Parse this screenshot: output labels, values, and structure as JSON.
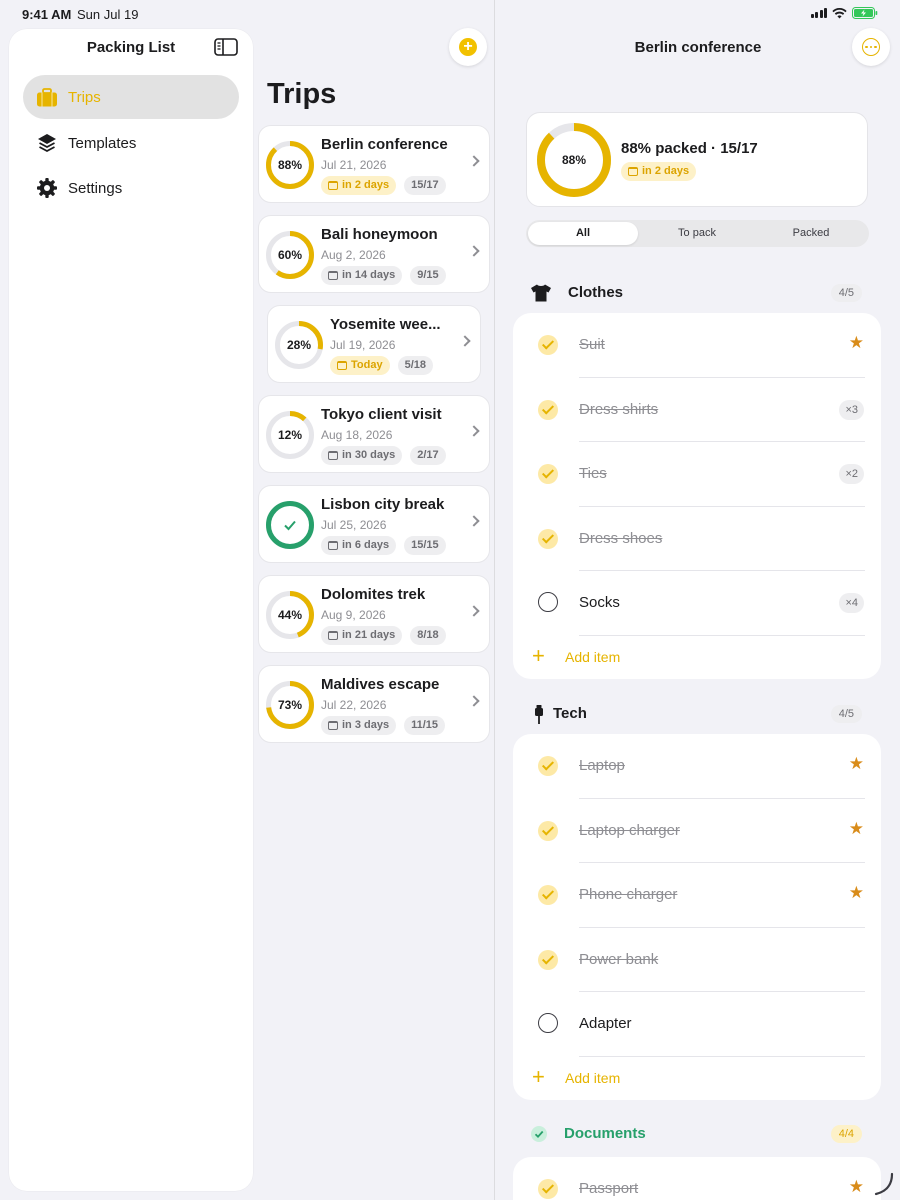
{
  "status": {
    "time": "9:41 AM",
    "date": "Sun Jul 19"
  },
  "sidebar": {
    "title": "Packing List",
    "items": [
      {
        "label": "Trips",
        "icon": "suitcase-icon",
        "active": true
      },
      {
        "label": "Templates",
        "icon": "layers-icon",
        "active": false
      },
      {
        "label": "Settings",
        "icon": "gear-icon",
        "active": false
      }
    ]
  },
  "trips": {
    "title": "Trips",
    "list": [
      {
        "name": "Berlin conference",
        "date": "Jul 21, 2026",
        "when": "in 2 days",
        "count": "15/17",
        "percent_label": "88%",
        "progress": 0.88,
        "urgent": true
      },
      {
        "name": "Bali honeymoon",
        "date": "Aug 2, 2026",
        "when": "in 14 days",
        "count": "9/15",
        "percent_label": "60%",
        "progress": 0.6,
        "urgent": false
      },
      {
        "name": "Yosemite wee...",
        "date": "Jul 19, 2026",
        "when": "Today",
        "count": "5/18",
        "percent_label": "28%",
        "progress": 0.28,
        "urgent": true
      },
      {
        "name": "Tokyo client visit",
        "date": "Aug 18, 2026",
        "when": "in 30 days",
        "count": "2/17",
        "percent_label": "12%",
        "progress": 0.12,
        "urgent": false
      },
      {
        "name": "Lisbon city break",
        "date": "Jul 25, 2026",
        "when": "in 6 days",
        "count": "15/15",
        "percent_label": "",
        "progress": 1.0,
        "urgent": false
      },
      {
        "name": "Dolomites trek",
        "date": "Aug 9, 2026",
        "when": "in 21 days",
        "count": "8/18",
        "percent_label": "44%",
        "progress": 0.44,
        "urgent": false
      },
      {
        "name": "Maldives escape",
        "date": "Jul 22, 2026",
        "when": "in 3 days",
        "count": "11/15",
        "percent_label": "73%",
        "progress": 0.73,
        "urgent": false
      }
    ]
  },
  "detail": {
    "title": "Berlin conference",
    "summary": {
      "percent_label": "88%",
      "progress": 0.88,
      "text": "88% packed · 15/17",
      "when": "in 2 days"
    },
    "filters": [
      "All",
      "To pack",
      "Packed"
    ],
    "active_filter": "All",
    "categories": [
      {
        "name": "Clothes",
        "count": "4/5",
        "icon": "tshirt-icon",
        "items": [
          {
            "label": "Suit",
            "packed": true,
            "star": true,
            "qty": ""
          },
          {
            "label": "Dress shirts",
            "packed": true,
            "star": false,
            "qty": "×3"
          },
          {
            "label": "Ties",
            "packed": true,
            "star": false,
            "qty": "×2"
          },
          {
            "label": "Dress shoes",
            "packed": true,
            "star": false,
            "qty": ""
          },
          {
            "label": "Socks",
            "packed": false,
            "star": false,
            "qty": "×4"
          }
        ],
        "add_label": "Add item"
      },
      {
        "name": "Tech",
        "count": "4/5",
        "icon": "cable-icon",
        "items": [
          {
            "label": "Laptop",
            "packed": true,
            "star": true,
            "qty": ""
          },
          {
            "label": "Laptop charger",
            "packed": true,
            "star": true,
            "qty": ""
          },
          {
            "label": "Phone charger",
            "packed": true,
            "star": true,
            "qty": ""
          },
          {
            "label": "Power bank",
            "packed": true,
            "star": false,
            "qty": ""
          },
          {
            "label": "Adapter",
            "packed": false,
            "star": false,
            "qty": ""
          }
        ],
        "add_label": "Add item"
      },
      {
        "name": "Documents",
        "count": "4/4",
        "icon": "check-circle-icon",
        "items": [
          {
            "label": "Passport",
            "packed": true,
            "star": true,
            "qty": ""
          }
        ]
      }
    ]
  },
  "colors": {
    "accent": "#e6b400",
    "success": "#27a06b",
    "track": "#e6e6ea"
  }
}
